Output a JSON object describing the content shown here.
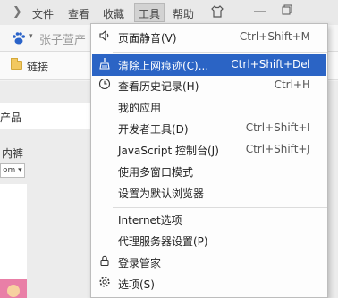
{
  "menubar": {
    "items": [
      {
        "label": "文件"
      },
      {
        "label": "查看"
      },
      {
        "label": "收藏"
      },
      {
        "label": "工具"
      },
      {
        "label": "帮助"
      }
    ],
    "chevron_icon": "chevron-right-icon",
    "window_controls": [
      "shirt-icon",
      "minimize-icon",
      "restore-icon"
    ]
  },
  "address": {
    "query_text": "张子萱产"
  },
  "bookmarks": {
    "folder_label": "链接"
  },
  "page": {
    "fragment1": "产品",
    "fragment2": "内裤",
    "select_value": "om"
  },
  "tools_menu": {
    "items": [
      {
        "label": "页面静音(V)",
        "shortcut": "Ctrl+Shift+M",
        "icon": "speaker-icon",
        "highlighted": false
      },
      {
        "label": "清除上网痕迹(C)...",
        "shortcut": "Ctrl+Shift+Del",
        "icon": "broom-icon",
        "highlighted": true
      },
      {
        "label": "查看历史记录(H)",
        "shortcut": "Ctrl+H",
        "icon": "clock-icon",
        "highlighted": false
      },
      {
        "label": "我的应用",
        "shortcut": "",
        "icon": "",
        "highlighted": false
      },
      {
        "label": "开发者工具(D)",
        "shortcut": "Ctrl+Shift+I",
        "icon": "",
        "highlighted": false
      },
      {
        "label": "JavaScript 控制台(J)",
        "shortcut": "Ctrl+Shift+J",
        "icon": "",
        "highlighted": false
      },
      {
        "label": "使用多窗口模式",
        "shortcut": "",
        "icon": "",
        "highlighted": false
      },
      {
        "label": "设置为默认浏览器",
        "shortcut": "",
        "icon": "",
        "highlighted": false
      },
      {
        "label": "Internet选项",
        "shortcut": "",
        "icon": "",
        "highlighted": false
      },
      {
        "label": "代理服务器设置(P)",
        "shortcut": "",
        "icon": "",
        "highlighted": false
      },
      {
        "label": "登录管家",
        "shortcut": "",
        "icon": "lock-icon",
        "highlighted": false
      },
      {
        "label": "选项(S)",
        "shortcut": "",
        "icon": "gear-icon",
        "highlighted": false
      }
    ]
  },
  "colors": {
    "highlight": "#2b64c5",
    "menu_bg": "#fdfdfd"
  }
}
